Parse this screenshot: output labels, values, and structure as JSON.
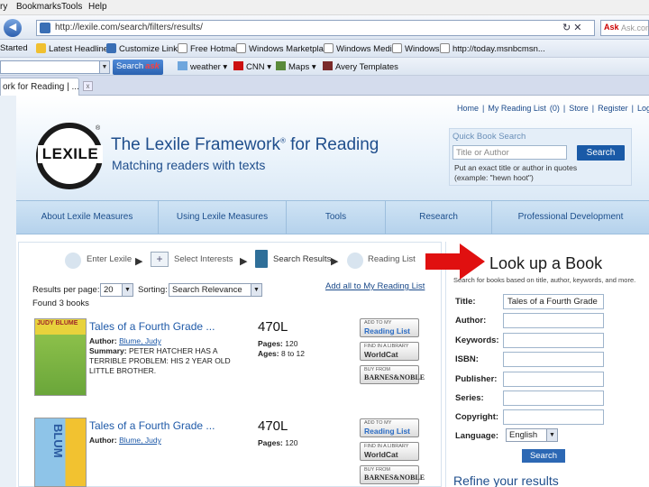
{
  "browser": {
    "menu": [
      "ry",
      "Bookmarks",
      "Tools",
      "Help"
    ],
    "url": "http://lexile.com/search/filters/results/",
    "ask_placeholder": "Ask.com",
    "favorites": [
      "Started",
      "Latest Headlines",
      "Customize Links",
      "Free Hotmail",
      "Windows Marketplace",
      "Windows Media",
      "Windows",
      "http://today.msnbcmsn..."
    ],
    "toolbar": {
      "search_label": "Search",
      "search_brand": "ask",
      "weather": "weather ▾",
      "cnn": "CNN ▾",
      "maps": "Maps ▾",
      "templates": "Avery Templates"
    },
    "tab_title": "ork for Reading | ...",
    "tab_close": "x"
  },
  "header": {
    "toplinks": [
      "Home",
      "|",
      "My Reading List",
      "(0)",
      "|",
      "Store",
      "|",
      "Register",
      "|",
      "Login"
    ],
    "logo_text": "LEXILE",
    "logo_reg": "®",
    "title": "The Lexile Framework",
    "title_reg": "®",
    "title_suffix": " for Reading",
    "subtitle": "Matching readers with texts",
    "quick_search": {
      "title": "Quick Book Search",
      "placeholder": "Title or Author",
      "button": "Search",
      "help": "Put an exact title or author in quotes (example: \"hewn hoot\")"
    }
  },
  "nav": [
    "About Lexile Measures",
    "Using Lexile Measures",
    "Tools",
    "Research",
    "Professional Development"
  ],
  "steps": [
    "Enter Lexile",
    "Select Interests",
    "Search Results",
    "Reading List"
  ],
  "step_icons": [
    "+"
  ],
  "results": {
    "per_page_label": "Results per page:",
    "per_page_value": "20",
    "sorting_label": "Sorting:",
    "sorting_value": "Search Relevance",
    "add_to_list": "Add all to My Reading List",
    "found": "Found 3 books",
    "books": [
      {
        "title": "Tales of a Fourth Grade ...",
        "author_label": "Author:",
        "author": "Blume, Judy",
        "summary_label": "Summary:",
        "summary": "PETER HATCHER HAS A TERRIBLE PROBLEM: HIS 2 YEAR OLD LITTLE BROTHER.",
        "lexile": "470L",
        "pages_label": "Pages:",
        "pages": "120",
        "ages_label": "Ages:",
        "ages": "8 to 12",
        "cover_text": "JUDY BLUME"
      },
      {
        "title": "Tales of a Fourth Grade ...",
        "author_label": "Author:",
        "author": "Blume, Judy",
        "lexile": "470L",
        "pages_label": "Pages:",
        "pages": "120",
        "cover_text": "BLUM"
      }
    ],
    "badges": {
      "reading_list_small": "ADD TO MY",
      "reading_list": "Reading List",
      "worldcat_small": "FIND IN A LIBRARY",
      "worldcat": "WorldCat",
      "bn_small": "BUY FROM",
      "bn": "BARNES&NOBLE"
    }
  },
  "lookup": {
    "title": "Look up a Book",
    "help": "Search for books based on title, author, keywords, and more.",
    "fields": [
      {
        "label": "Title:",
        "value": "Tales of a Fourth Grade"
      },
      {
        "label": "Author:",
        "value": ""
      },
      {
        "label": "Keywords:",
        "value": ""
      },
      {
        "label": "ISBN:",
        "value": ""
      },
      {
        "label": "Publisher:",
        "value": ""
      },
      {
        "label": "Series:",
        "value": ""
      },
      {
        "label": "Copyright:",
        "value": ""
      },
      {
        "label": "Language:",
        "value": "English"
      }
    ],
    "search_button": "Search",
    "refine": "Refine your results"
  },
  "colors": {
    "brand_blue": "#1f4e8c",
    "nav_bg": "#b5d2ec",
    "search_button": "#1a5aa7",
    "arrow_red": "#e01010"
  },
  "icons": [
    "back-icon",
    "favicon",
    "refresh-icon",
    "stop-icon",
    "ask-logo-icon",
    "star-icon",
    "step-icon",
    "arrow-icon",
    "dropdown-arrow-icon",
    "red-arrow-icon"
  ]
}
